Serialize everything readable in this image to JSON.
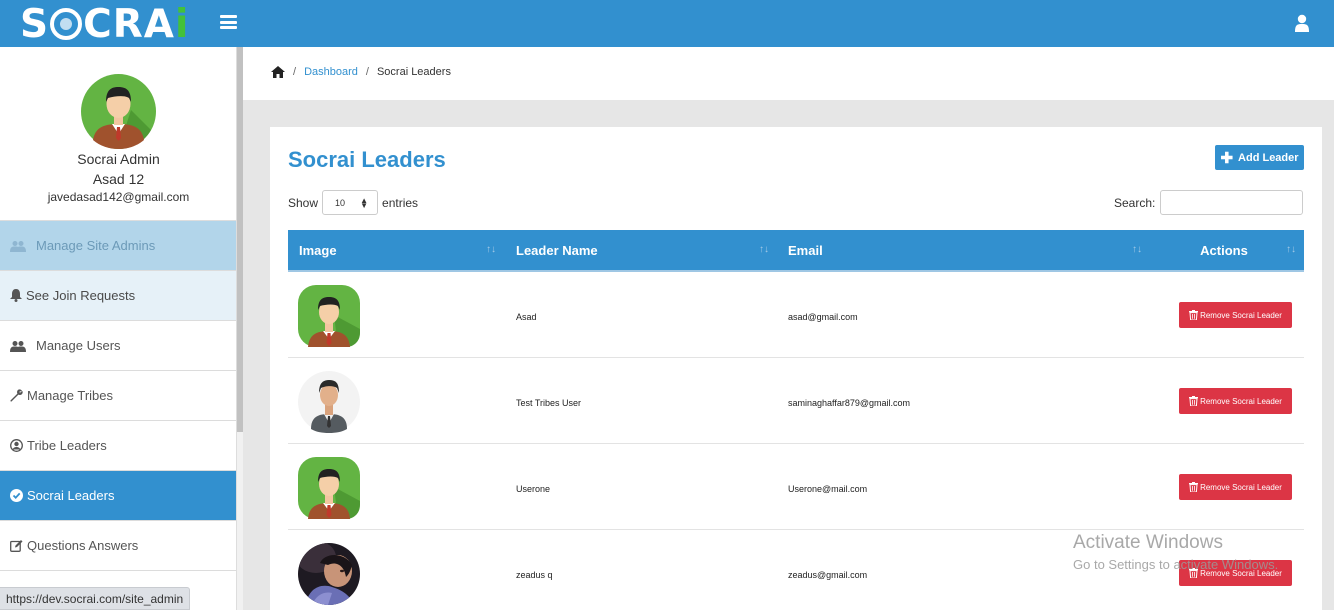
{
  "app": {
    "logo_text": "SOCRAI",
    "brand_color": "#3290cf"
  },
  "sidebar": {
    "profile": {
      "role": "Socrai Admin",
      "name": "Asad 12",
      "email": "javedasad142@gmail.com"
    },
    "items": [
      {
        "label": "Manage Site Admins",
        "icon": "users-icon",
        "state": "faded"
      },
      {
        "label": "See Join Requests",
        "icon": "bell-icon",
        "state": "light"
      },
      {
        "label": "Manage Users",
        "icon": "users-icon",
        "state": "normal"
      },
      {
        "label": "Manage Tribes",
        "icon": "wrench-icon",
        "state": "normal"
      },
      {
        "label": "Tribe Leaders",
        "icon": "user-circle-icon",
        "state": "normal"
      },
      {
        "label": "Socrai Leaders",
        "icon": "check-circle-icon",
        "state": "active"
      },
      {
        "label": "Questions Answers",
        "icon": "edit-icon",
        "state": "normal"
      }
    ]
  },
  "breadcrumb": {
    "home_icon": "home-icon",
    "dashboard": "Dashboard",
    "current": "Socrai Leaders"
  },
  "main": {
    "title": "Socrai Leaders",
    "add_button": "Add Leader",
    "show_label": "Show",
    "entries_value": "10",
    "entries_label": "entries",
    "search_label": "Search:",
    "search_value": ""
  },
  "table": {
    "headers": [
      "Image",
      "Leader Name",
      "Email",
      "Actions"
    ],
    "rows": [
      {
        "avatar": "green-avatar",
        "name": "Asad",
        "email": "asad@gmail.com",
        "action": "Remove Socrai Leader"
      },
      {
        "avatar": "suit-avatar",
        "name": "Test Tribes User",
        "email": "saminaghaffar879@gmail.com",
        "action": "Remove Socrai Leader"
      },
      {
        "avatar": "green-avatar",
        "name": "Userone",
        "email": "Userone@mail.com",
        "action": "Remove Socrai Leader"
      },
      {
        "avatar": "photo-avatar",
        "name": "zeadus q",
        "email": "zeadus@gmail.com",
        "action": "Remove Socrai Leader"
      }
    ]
  },
  "status_url": "https://dev.socrai.com/site_admin",
  "watermark": {
    "line1": "Activate Windows",
    "line2": "Go to Settings to activate Windows."
  }
}
